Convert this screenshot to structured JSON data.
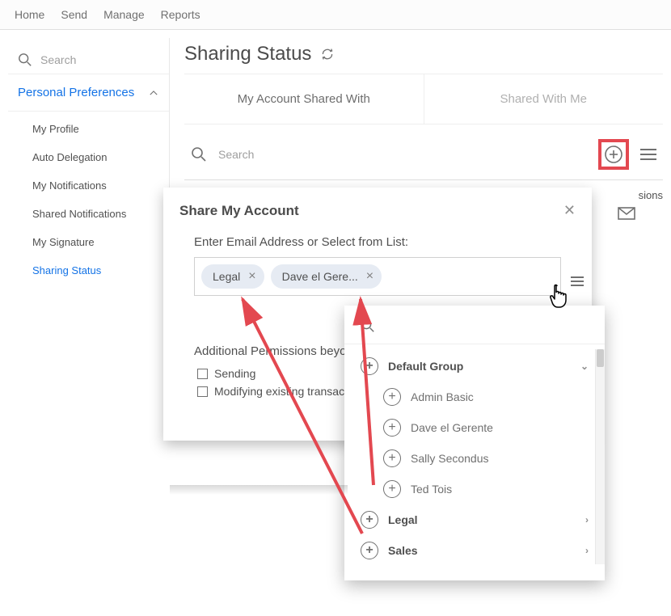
{
  "nav": {
    "home": "Home",
    "send": "Send",
    "manage": "Manage",
    "reports": "Reports"
  },
  "sidebar": {
    "search_placeholder": "Search",
    "section": "Personal Preferences",
    "items": [
      "My Profile",
      "Auto Delegation",
      "My Notifications",
      "Shared Notifications",
      "My Signature",
      "Sharing Status"
    ]
  },
  "page": {
    "title": "Sharing Status"
  },
  "tabs": {
    "a": "My Account Shared With",
    "b": "Shared With Me"
  },
  "searchbar": {
    "placeholder": "Search"
  },
  "perm_label_fragment": "sions",
  "dialog": {
    "title": "Share My Account",
    "prompt": "Enter Email Address or Select from List:",
    "chips": [
      {
        "label": "Legal"
      },
      {
        "label": "Dave el Gere..."
      }
    ],
    "additional_label": "Additional Permissions beyon",
    "checkboxes": [
      "Sending",
      "Modifying existing transacti"
    ]
  },
  "dropdown": {
    "groups": [
      {
        "name": "Default Group",
        "expanded": true,
        "items": [
          "Admin Basic",
          "Dave el Gerente",
          "Sally Secondus",
          "Ted Tois"
        ]
      },
      {
        "name": "Legal",
        "expanded": false,
        "items": []
      },
      {
        "name": "Sales",
        "expanded": false,
        "items": []
      }
    ]
  }
}
